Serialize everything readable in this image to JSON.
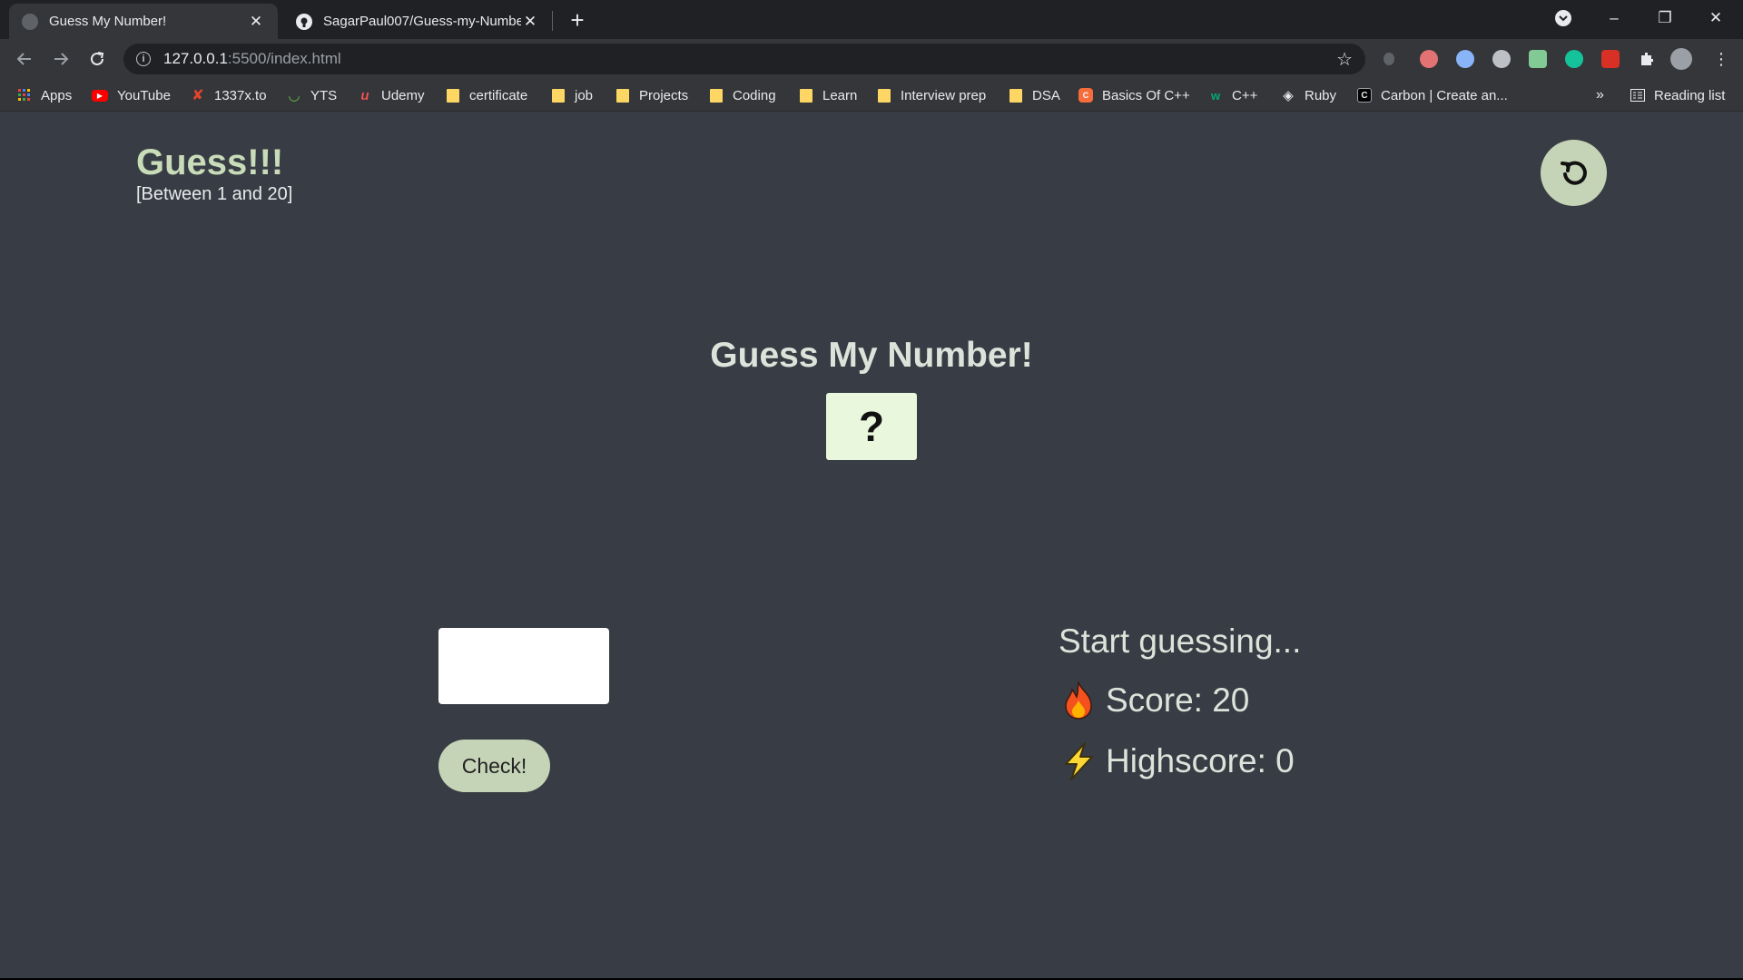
{
  "browser": {
    "tabs": [
      {
        "title": "Guess My Number!",
        "close": "✕"
      },
      {
        "title": "SagarPaul007/Guess-my-Number",
        "close": "✕"
      }
    ],
    "new_tab": "+",
    "window_controls": {
      "minimize": "–",
      "restore": "❐",
      "close": "✕"
    },
    "address": {
      "host": "127.0.0.1",
      "rest": ":5500/index.html"
    },
    "bookmarks": [
      {
        "label": "Apps",
        "icon": "apps-grid-icon"
      },
      {
        "label": "YouTube",
        "icon": "youtube-icon"
      },
      {
        "label": "1337x.to",
        "icon": "1337x-icon"
      },
      {
        "label": "YTS",
        "icon": "yts-icon"
      },
      {
        "label": "Udemy",
        "icon": "udemy-icon"
      },
      {
        "label": "certificate",
        "icon": "folder-icon"
      },
      {
        "label": "job",
        "icon": "folder-icon"
      },
      {
        "label": "Projects",
        "icon": "folder-icon"
      },
      {
        "label": "Coding",
        "icon": "folder-icon"
      },
      {
        "label": "Learn",
        "icon": "folder-icon"
      },
      {
        "label": "Interview prep",
        "icon": "folder-icon"
      },
      {
        "label": "DSA",
        "icon": "folder-icon"
      },
      {
        "label": "Basics Of C++",
        "icon": "codingninjas-icon"
      },
      {
        "label": "C++",
        "icon": "w3-icon"
      },
      {
        "label": "Ruby",
        "icon": "ruby-icon"
      },
      {
        "label": "Carbon | Create an...",
        "icon": "carbon-icon"
      }
    ],
    "bookmarks_overflow": "»",
    "reading_list": "Reading list"
  },
  "game": {
    "brand_title": "Guess!!!",
    "range_hint": "[Between 1 and 20]",
    "heading": "Guess My Number!",
    "secret_number": "?",
    "guess_value": "",
    "check_label": "Check!",
    "message": "Start guessing...",
    "score_label": "Score: 20",
    "highscore_label": "Highscore: 0"
  },
  "colors": {
    "page_bg": "#383c44",
    "accent": "#c5d4b7",
    "number_box": "#e9f7dd"
  }
}
